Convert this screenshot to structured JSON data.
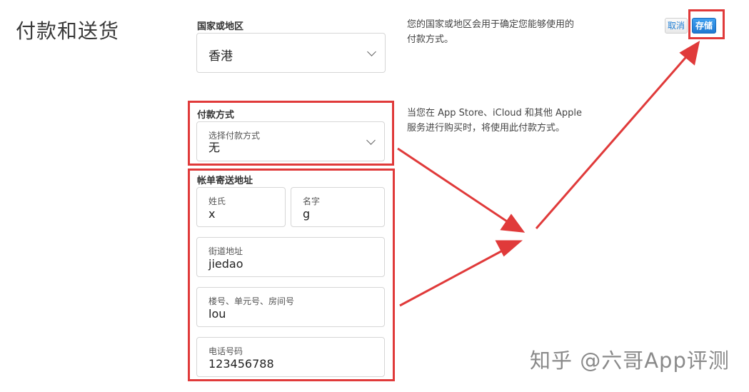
{
  "page": {
    "title": "付款和送货"
  },
  "country": {
    "label": "国家或地区",
    "value": "香港",
    "info": [
      "您的国家或地区会用于确定您能够使用的",
      "付款方式。"
    ]
  },
  "payment": {
    "section_label": "付款方式",
    "select_label": "选择付款方式",
    "value": "无",
    "info": [
      "当您在 App Store、iCloud 和其他 Apple",
      "服务进行购买时，将使用此付款方式。"
    ]
  },
  "billing": {
    "section_label": "帐单寄送地址",
    "last_name": {
      "label": "姓氏",
      "value": "x"
    },
    "first_name": {
      "label": "名字",
      "value": "g"
    },
    "street": {
      "label": "街道地址",
      "value": "jiedao"
    },
    "unit": {
      "label": "楼号、单元号、房间号",
      "value": "lou"
    },
    "phone": {
      "label": "电话号码",
      "value": "123456788"
    }
  },
  "actions": {
    "cancel": "取消",
    "save": "存储"
  },
  "watermark": "知乎 @六哥App评测",
  "colors": {
    "highlight": "#e03a3a",
    "primary_button": "#1f78d1"
  }
}
